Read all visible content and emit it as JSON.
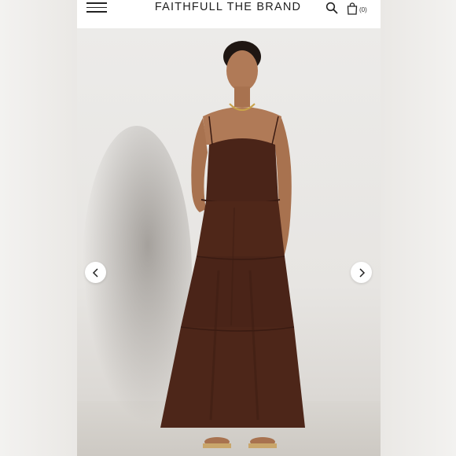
{
  "header": {
    "brand": "FAITHFULL THE BRAND",
    "cart_count": "(0)"
  },
  "icons": {
    "menu": "hamburger-menu-icon",
    "search": "search-icon",
    "cart": "shopping-bag-icon",
    "prev": "chevron-left-icon",
    "next": "chevron-right-icon"
  },
  "product_image": {
    "description_color": "#4a2418"
  },
  "colors": {
    "background": "#ffffff",
    "dress": "#4a2418",
    "text": "#1e1e1e"
  }
}
